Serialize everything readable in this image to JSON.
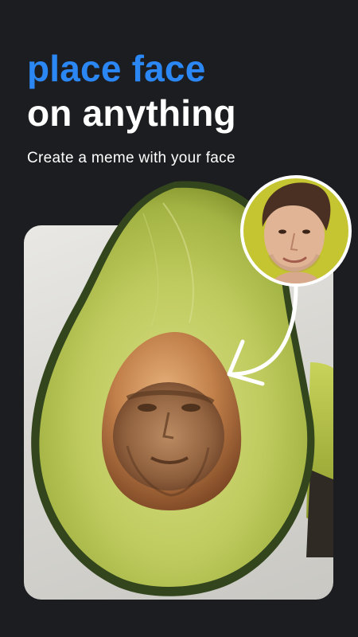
{
  "headline": {
    "line1": "place face",
    "line2": "on anything"
  },
  "subtitle": "Create a meme with your face",
  "colors": {
    "background": "#1c1d21",
    "accent": "#2b87f4",
    "text": "#ffffff",
    "avatar_background": "#c5c531"
  },
  "icons": {
    "arrow": "curved-arrow-icon"
  }
}
